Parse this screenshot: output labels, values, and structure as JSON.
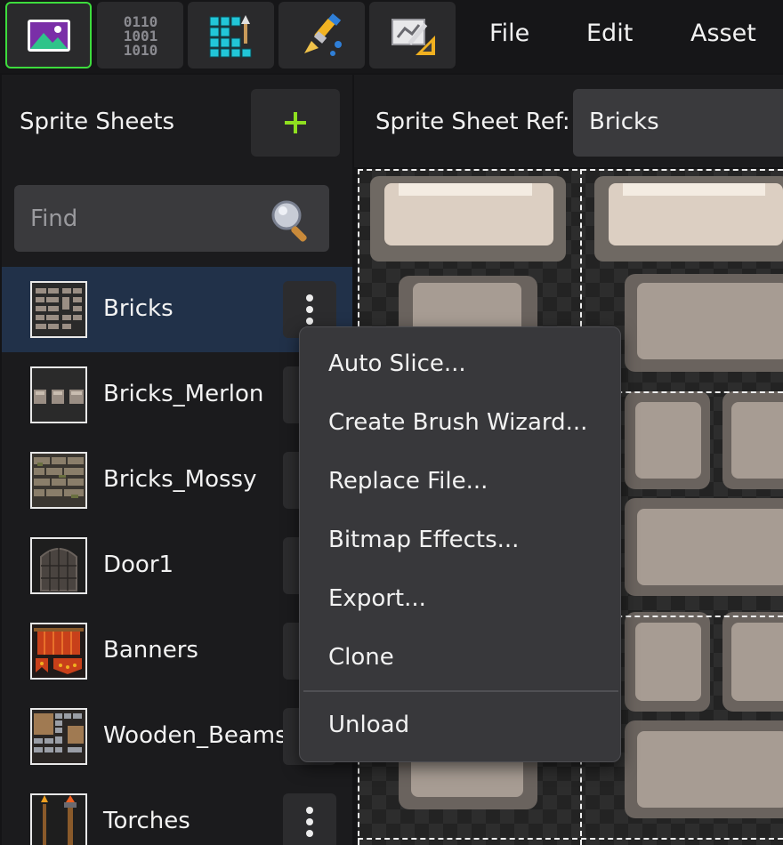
{
  "menu": {
    "file": "File",
    "edit": "Edit",
    "asset": "Asset"
  },
  "left_panel": {
    "title": "Sprite Sheets",
    "search_placeholder": "Find",
    "items": [
      {
        "label": "Bricks"
      },
      {
        "label": "Bricks_Merlon"
      },
      {
        "label": "Bricks_Mossy"
      },
      {
        "label": "Door1"
      },
      {
        "label": "Banners"
      },
      {
        "label": "Wooden_Beams"
      },
      {
        "label": "Torches"
      }
    ]
  },
  "right_panel": {
    "ref_label": "Sprite Sheet Ref:",
    "ref_value": "Bricks"
  },
  "context_menu": {
    "items": [
      {
        "label": "Auto Slice..."
      },
      {
        "label": "Create Brush Wizard..."
      },
      {
        "label": "Replace File..."
      },
      {
        "label": "Bitmap Effects..."
      },
      {
        "label": "Export..."
      },
      {
        "label": "Clone"
      },
      {
        "label": "Unload"
      }
    ]
  },
  "colors": {
    "accent_green": "#3ddc3d",
    "selected_row": "#213149",
    "panel_bg": "#1b1b1d",
    "menu_bg": "#38383b"
  },
  "icons": {
    "tool_1": "image-editor-icon",
    "tool_2": "binary-data-icon",
    "tool_3": "tilemap-icon",
    "tool_4": "paint-brush-icon",
    "tool_5": "sprite-edit-icon",
    "add": "plus-icon",
    "search": "magnifier-icon"
  }
}
